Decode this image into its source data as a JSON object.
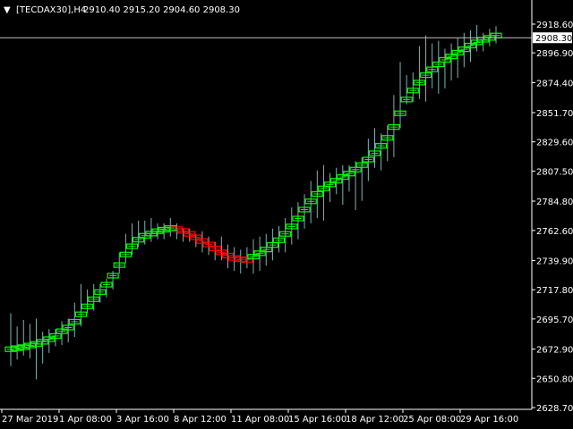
{
  "window": {
    "symbol_label": "[TECDAX30],H4",
    "ohlc_text": "2910.40 2915.20 2904.60 2908.30",
    "menu_glyph": "▼"
  },
  "colors": {
    "background": "#000000",
    "axis": "#ffffff",
    "up_box": "#00ff00",
    "down_box": "#ff0000",
    "wick": "#7fb3b3",
    "price_line": "#c0c0c0",
    "tag_bg": "#ffffff",
    "tag_text": "#000000"
  },
  "chart_data": {
    "type": "line",
    "title": "",
    "current_price": 2908.3,
    "current_price_label": "2908.30",
    "ylim": [
      2626.0,
      2924.0
    ],
    "y_ticks": [
      {
        "value": 2918.6,
        "label": "2918.60"
      },
      {
        "value": 2896.9,
        "label": "2896.90"
      },
      {
        "value": 2874.4,
        "label": "2874.40"
      },
      {
        "value": 2851.7,
        "label": "2851.70"
      },
      {
        "value": 2829.6,
        "label": "2829.60"
      },
      {
        "value": 2807.5,
        "label": "2807.50"
      },
      {
        "value": 2784.8,
        "label": "2784.80"
      },
      {
        "value": 2762.6,
        "label": "2762.60"
      },
      {
        "value": 2739.9,
        "label": "2739.90"
      },
      {
        "value": 2717.8,
        "label": "2717.80"
      },
      {
        "value": 2695.7,
        "label": "2695.70"
      },
      {
        "value": 2672.9,
        "label": "2672.90"
      },
      {
        "value": 2650.8,
        "label": "2650.80"
      },
      {
        "value": 2628.7,
        "label": "2628.70"
      }
    ],
    "x_ticks": [
      {
        "index": 0,
        "label": "27 Mar 2019"
      },
      {
        "index": 8,
        "label": "1 Apr 08:00"
      },
      {
        "index": 16,
        "label": "3 Apr 16:00"
      },
      {
        "index": 24,
        "label": "8 Apr 12:00"
      },
      {
        "index": 32,
        "label": "11 Apr 08:00"
      },
      {
        "index": 40,
        "label": "15 Apr 16:00"
      },
      {
        "index": 48,
        "label": "18 Apr 12:00"
      },
      {
        "index": 56,
        "label": "25 Apr 08:00"
      },
      {
        "index": 64,
        "label": "29 Apr 16:00"
      }
    ],
    "bar_count": 68,
    "series": [
      {
        "values": [
          2672.8,
          2673.6,
          2674.4,
          2675.6,
          2676.8,
          2678.4,
          2680.4,
          2682.8,
          2686.4,
          2689.2,
          2693.6,
          2699.2,
          2705.2,
          2710.6,
          2716.0,
          2721.6,
          2728.4,
          2736.4,
          2744.4,
          2750.6,
          2755.6,
          2758.6,
          2760.2,
          2762.0,
          2763.2,
          2764.4,
          2763.6,
          2762.2,
          2760.0,
          2757.4,
          2754.6,
          2752.0,
          2749.0,
          2746.0,
          2743.6,
          2741.8,
          2740.8,
          2740.4,
          2742.8,
          2745.4,
          2748.2,
          2751.6,
          2755.2,
          2760.0,
          2765.6,
          2771.6,
          2778.4,
          2784.6,
          2790.2,
          2794.4,
          2797.4,
          2800.2,
          2803.0,
          2805.6,
          2808.6,
          2812.0,
          2816.2,
          2821.0,
          2826.6,
          2832.6,
          2840.8,
          2851.2,
          2861.6,
          2868.4,
          2874.4,
          2880.0,
          2884.4,
          2888.2,
          2891.6,
          2894.2,
          2897.0,
          2899.6,
          2902.4,
          2904.8,
          2906.8,
          2908.2,
          2910.0
        ],
        "highs": [
          2700,
          2690,
          2695,
          2692,
          2696,
          2686,
          2688,
          2688,
          2694,
          2696,
          2708,
          2722,
          2718,
          2722,
          2722,
          2726,
          2732,
          2746,
          2760,
          2768,
          2770,
          2770,
          2772,
          2768,
          2768,
          2772,
          2768,
          2764,
          2764,
          2760,
          2762,
          2758,
          2754,
          2758,
          2752,
          2750,
          2748,
          2750,
          2756,
          2758,
          2760,
          2764,
          2766,
          2772,
          2780,
          2784,
          2790,
          2800,
          2808,
          2812,
          2806,
          2810,
          2812,
          2812,
          2815,
          2818,
          2832,
          2840,
          2836,
          2842,
          2865,
          2890,
          2880,
          2882,
          2902,
          2910,
          2904,
          2906,
          2900,
          2904,
          2908,
          2912,
          2914,
          2918,
          2912,
          2915,
          2917
        ],
        "lows": [
          2660,
          2665,
          2668,
          2666,
          2650,
          2662,
          2670,
          2675,
          2676,
          2678,
          2682,
          2690,
          2700,
          2702,
          2708,
          2712,
          2718,
          2730,
          2738,
          2744,
          2750,
          2752,
          2754,
          2756,
          2756,
          2758,
          2756,
          2754,
          2754,
          2750,
          2746,
          2744,
          2740,
          2740,
          2734,
          2732,
          2730,
          2734,
          2730,
          2732,
          2736,
          2740,
          2746,
          2746,
          2752,
          2756,
          2764,
          2768,
          2772,
          2770,
          2784,
          2790,
          2782,
          2792,
          2778,
          2785,
          2800,
          2810,
          2808,
          2815,
          2818,
          2840,
          2858,
          2860,
          2862,
          2860,
          2870,
          2866,
          2870,
          2876,
          2878,
          2886,
          2890,
          2898,
          2898,
          2902,
          2904
        ]
      }
    ],
    "trend": "up-green / down-red renko-style boxes",
    "grid": false
  }
}
